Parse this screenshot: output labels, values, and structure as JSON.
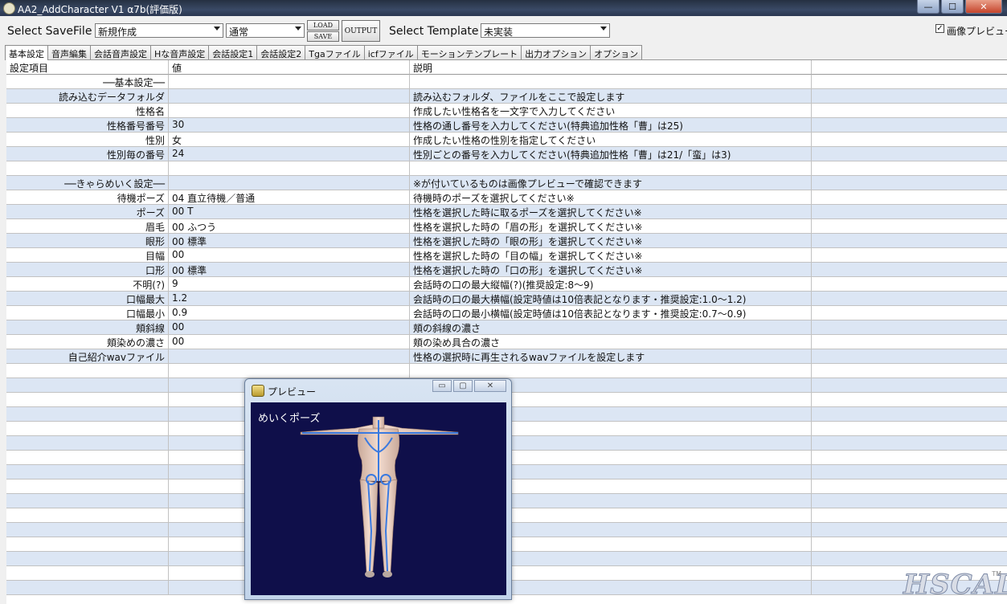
{
  "window": {
    "title": "AA2_AddCharacter V1 α7b(評価版)",
    "close_glyph": "✕",
    "minimize_glyph": "—",
    "maximize_glyph": "☐"
  },
  "toolbar": {
    "select_savefile_label": "Select SaveFile",
    "savefile_value": "新規作成",
    "mode_value": "通常",
    "load_label": "LOAD",
    "save_label": "SAVE",
    "output_label": "OUTPUT",
    "select_template_label": "Select Template",
    "template_value": "未実装",
    "image_preview_label": "画像プレビュー",
    "image_preview_checked": true
  },
  "tabs": [
    {
      "label": "基本設定",
      "active": true
    },
    {
      "label": "音声編集"
    },
    {
      "label": "会話音声設定"
    },
    {
      "label": "Hな音声設定"
    },
    {
      "label": "会話設定1"
    },
    {
      "label": "会話設定2"
    },
    {
      "label": "Tgaファイル"
    },
    {
      "label": "icfファイル"
    },
    {
      "label": "モーションテンプレート"
    },
    {
      "label": "出力オプション"
    },
    {
      "label": "オプション"
    }
  ],
  "grid": {
    "headers": [
      "設定項目",
      "値",
      "説明"
    ],
    "rows": [
      {
        "item": "──基本設定──",
        "value": "",
        "desc": ""
      },
      {
        "item": "読み込むデータフォルダ",
        "value": "",
        "desc": "読み込むフォルダ、ファイルをここで設定します"
      },
      {
        "item": "性格名",
        "value": "",
        "desc": "作成したい性格名を一文字で入力してください"
      },
      {
        "item": "性格番号番号",
        "value": "30",
        "desc": "性格の通し番号を入力してください(特典追加性格「曹」は25)"
      },
      {
        "item": "性別",
        "value": "女",
        "desc": "作成したい性格の性別を指定してください"
      },
      {
        "item": "性別毎の番号",
        "value": "24",
        "desc": "性別ごとの番号を入力してください(特典追加性格「曹」は21/「蛮」は3)"
      },
      {
        "item": "",
        "value": "",
        "desc": ""
      },
      {
        "item": "──きゃらめいく設定──",
        "value": "",
        "desc": "※が付いているものは画像プレビューで確認できます"
      },
      {
        "item": "待機ポーズ",
        "value": "04  直立待機／普通",
        "desc": "待機時のポーズを選択してください※"
      },
      {
        "item": "ポーズ",
        "value": "00  T",
        "desc": "性格を選択した時に取るポーズを選択してください※"
      },
      {
        "item": "眉毛",
        "value": "00  ふつう",
        "desc": "性格を選択した時の「眉の形」を選択してください※"
      },
      {
        "item": "眼形",
        "value": "00  標準",
        "desc": "性格を選択した時の「眼の形」を選択してください※"
      },
      {
        "item": "目幅",
        "value": "00",
        "desc": "性格を選択した時の「目の幅」を選択してください※"
      },
      {
        "item": "口形",
        "value": "00  標準",
        "desc": "性格を選択した時の「口の形」を選択してください※"
      },
      {
        "item": "不明(?)",
        "value": "9",
        "desc": "会話時の口の最大縦幅(?)(推奨設定:8〜9)"
      },
      {
        "item": "口幅最大",
        "value": "1.2",
        "desc": "会話時の口の最大横幅(設定時値は10倍表記となります・推奨設定:1.0〜1.2)"
      },
      {
        "item": "口幅最小",
        "value": "0.9",
        "desc": "会話時の口の最小横幅(設定時値は10倍表記となります・推奨設定:0.7〜0.9)"
      },
      {
        "item": "頬斜線",
        "value": "00",
        "desc": "頬の斜線の濃さ"
      },
      {
        "item": "頬染めの濃さ",
        "value": "00",
        "desc": "頬の染め具合の濃さ"
      },
      {
        "item": "自己紹介wavファイル",
        "value": "",
        "desc": "性格の選択時に再生されるwavファイルを設定します"
      }
    ],
    "empty_rows": 16
  },
  "preview": {
    "title": "プレビュー",
    "pose_label": "めいくポーズ",
    "minimize_glyph": "▭",
    "maximize_glyph": "▢",
    "close_glyph": "✕"
  },
  "watermark": {
    "text": "HSCAL",
    "tm": "TM"
  },
  "colors": {
    "row_alt": "#dce6f4",
    "preview_bg": "#0f0f4a"
  }
}
